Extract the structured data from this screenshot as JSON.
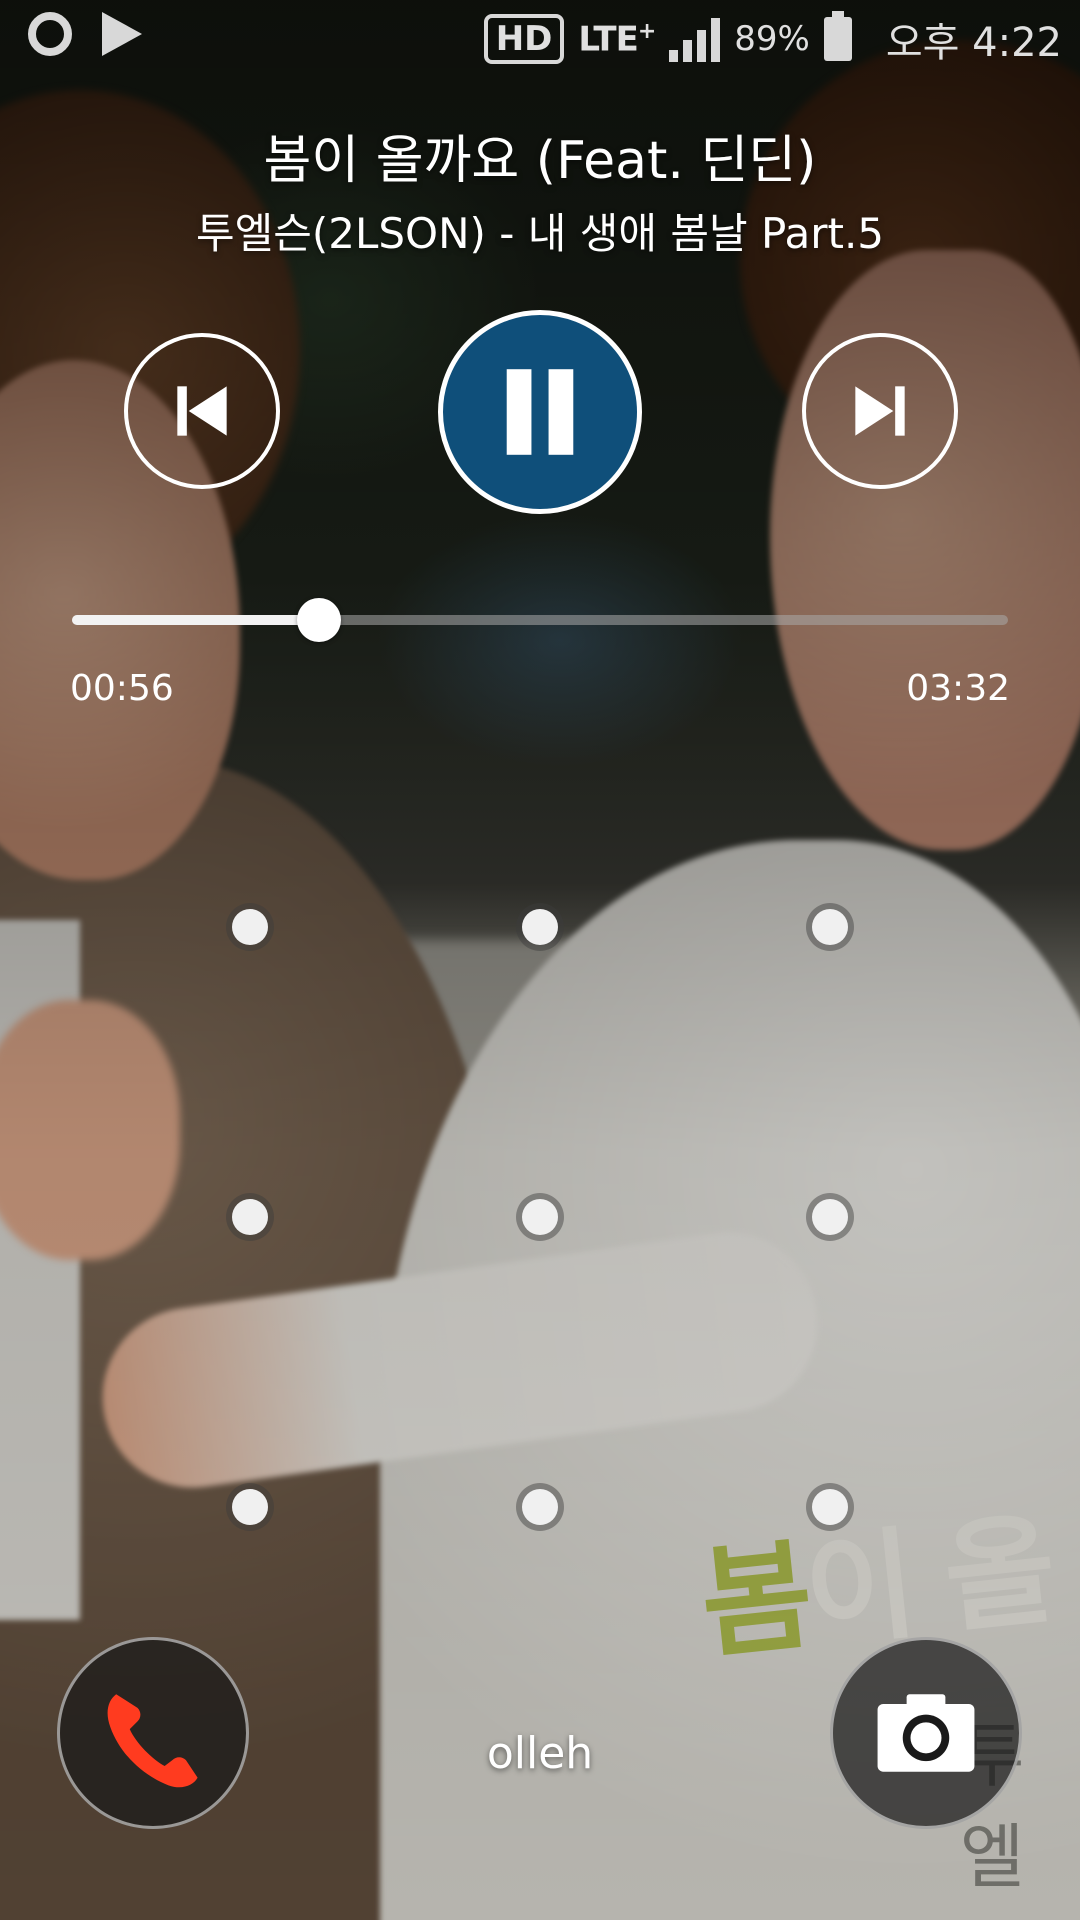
{
  "status_bar": {
    "hd": "HD",
    "network": "LTE",
    "network_suffix": "+",
    "battery": "89%",
    "clock": "오후 4:22",
    "icons": [
      "carrier-logo-icon",
      "media-playing-icon",
      "hd-voice-icon",
      "lte-icon",
      "signal-icon",
      "battery-icon"
    ]
  },
  "player": {
    "title": "봄이 올까요 (Feat. 딘딘)",
    "subtitle": "투엘슨(2LSON) - 내 생애 봄날 Part.5",
    "elapsed": "00:56",
    "total": "03:32",
    "progress_fraction": 0.264,
    "state": "playing",
    "accent_color": "#0f4f7a"
  },
  "artwork": {
    "title_part1": "봄",
    "title_part2": "이 올",
    "sub": "투엘"
  },
  "lock_screen": {
    "pattern_dots": 9,
    "carrier_label": "olleh",
    "shortcut_left": "phone-icon",
    "shortcut_right": "camera-icon",
    "phone_color": "#ff3b1f"
  }
}
